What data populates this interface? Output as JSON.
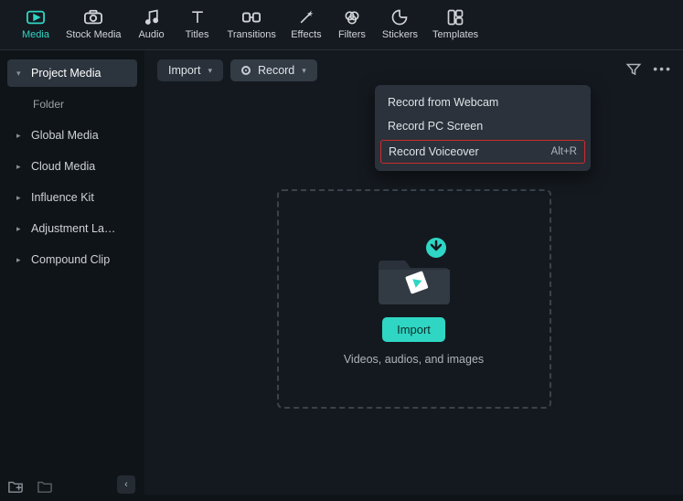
{
  "nav": [
    {
      "label": "Media",
      "icon": "media",
      "active": true
    },
    {
      "label": "Stock Media",
      "icon": "camera"
    },
    {
      "label": "Audio",
      "icon": "music"
    },
    {
      "label": "Titles",
      "icon": "text"
    },
    {
      "label": "Transitions",
      "icon": "transitions"
    },
    {
      "label": "Effects",
      "icon": "wand"
    },
    {
      "label": "Filters",
      "icon": "filters"
    },
    {
      "label": "Stickers",
      "icon": "sticker"
    },
    {
      "label": "Templates",
      "icon": "templates"
    }
  ],
  "sidebar": {
    "items": [
      {
        "label": "Project Media",
        "active": true,
        "expandable": true,
        "open": true
      },
      {
        "label": "Folder",
        "sub": true
      },
      {
        "label": "Global Media",
        "expandable": true
      },
      {
        "label": "Cloud Media",
        "expandable": true
      },
      {
        "label": "Influence Kit",
        "expandable": true
      },
      {
        "label": "Adjustment Layer",
        "expandable": true,
        "truncated": "Adjustment La…"
      },
      {
        "label": "Compound Clip",
        "expandable": true
      }
    ]
  },
  "toolbar": {
    "import_label": "Import",
    "record_label": "Record"
  },
  "record_menu": [
    {
      "label": "Record from Webcam"
    },
    {
      "label": "Record PC Screen"
    },
    {
      "label": "Record Voiceover",
      "shortcut": "Alt+R",
      "highlight": true
    }
  ],
  "dropzone": {
    "button": "Import",
    "hint": "Videos, audios, and images"
  },
  "colors": {
    "accent": "#2fd6c4",
    "highlight_border": "#cc2b2b"
  }
}
